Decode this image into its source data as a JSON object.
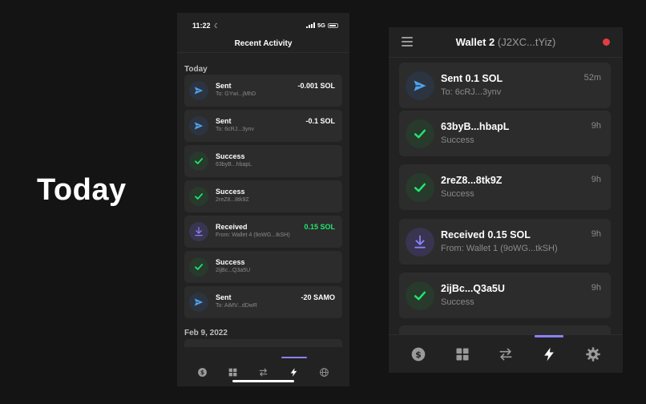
{
  "hero": {
    "text": "Today"
  },
  "phone": {
    "status": {
      "time": "11:22",
      "network": "5G"
    },
    "header_title": "Recent Activity",
    "sections": [
      {
        "label": "Today"
      },
      {
        "label": "Feb 9, 2022"
      }
    ],
    "items": [
      {
        "kind": "send",
        "title": "Sent",
        "subtitle": "To: GYwi...jMhD",
        "amount": "-0.001 SOL"
      },
      {
        "kind": "send",
        "title": "Sent",
        "subtitle": "To: 6cRJ...3ynv",
        "amount": "-0.1 SOL"
      },
      {
        "kind": "success",
        "title": "Success",
        "subtitle": "63byB...hbapL",
        "amount": ""
      },
      {
        "kind": "success",
        "title": "Success",
        "subtitle": "2reZ8...8tk9Z",
        "amount": ""
      },
      {
        "kind": "receive",
        "title": "Received",
        "subtitle": "From: Wallet 4 (9oWG...tkSH)",
        "amount": "0.15 SOL"
      },
      {
        "kind": "success",
        "title": "Success",
        "subtitle": "2ijBc...Q3a5U",
        "amount": ""
      },
      {
        "kind": "send",
        "title": "Sent",
        "subtitle": "To: AiMV...dDwR",
        "amount": "-20 SAMO"
      }
    ],
    "nav": [
      "dollar-icon",
      "grid-icon",
      "swap-icon",
      "bolt-icon",
      "globe-icon"
    ],
    "active_nav": "bolt-icon"
  },
  "ext": {
    "title": "Wallet 2",
    "address": "(J2XC...tYiz)",
    "network_dot_color": "#e33e3e",
    "items": [
      {
        "kind": "send",
        "title": "Sent 0.1 SOL",
        "subtitle": "To: 6cRJ...3ynv",
        "time": "52m"
      },
      {
        "kind": "success",
        "title": "63byB...hbapL",
        "subtitle": "Success",
        "time": "9h"
      },
      {
        "kind": "success",
        "title": "2reZ8...8tk9Z",
        "subtitle": "Success",
        "time": "9h"
      },
      {
        "kind": "receive",
        "title": "Received 0.15 SOL",
        "subtitle": "From: Wallet 1 (9oWG...tkSH)",
        "time": "9h"
      },
      {
        "kind": "success",
        "title": "2ijBc...Q3a5U",
        "subtitle": "Success",
        "time": "9h"
      }
    ],
    "nav": [
      "dollar-icon",
      "grid-icon",
      "swap-icon",
      "bolt-icon",
      "gear-icon"
    ],
    "active_nav": "bolt-icon"
  },
  "colors": {
    "background": "#141414",
    "panel": "#222222",
    "card": "#2c2c2c",
    "accent": "#8a81f8",
    "send_blue": "#4da3ef",
    "success_green": "#21e56f",
    "receive_purple": "#8a81f8",
    "muted_text": "#8a8a8a"
  }
}
